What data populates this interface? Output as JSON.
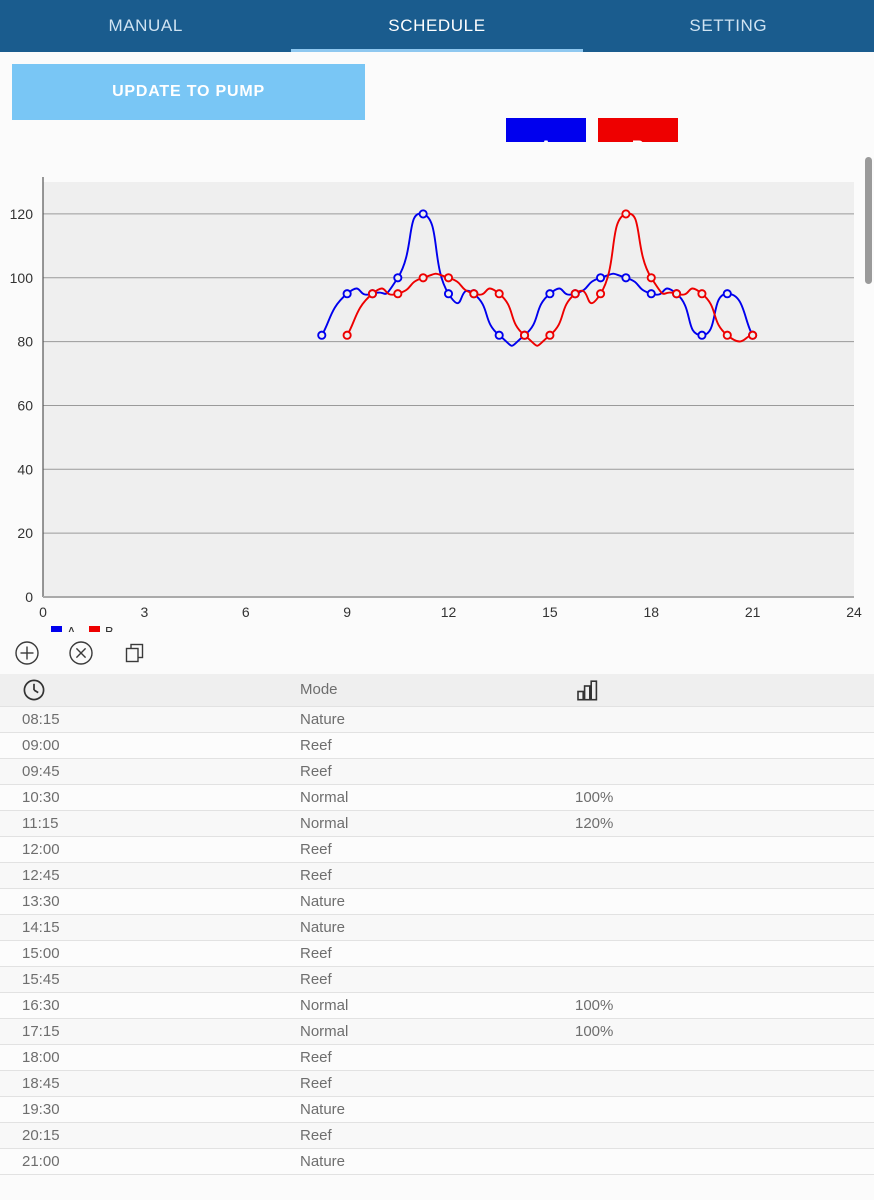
{
  "tabs": [
    {
      "label": "MANUAL",
      "active": false,
      "name": "tab-manual"
    },
    {
      "label": "SCHEDULE",
      "active": true,
      "name": "tab-schedule"
    },
    {
      "label": "SETTING",
      "active": false,
      "name": "tab-setting"
    }
  ],
  "toolbar": {
    "update_label": "UPDATE TO PUMP",
    "pump_a_label": "A",
    "pump_b_label": "B"
  },
  "colors": {
    "tabbar": "#1a5c8e",
    "tab_active_underline": "#8fc8f0",
    "update_button": "#79c6f5",
    "series_a": "#0000ee",
    "series_b": "#ee0000",
    "plot_background": "#efefef",
    "grid": "#9a9a9a"
  },
  "icon_toolbar": [
    {
      "name": "add-icon",
      "glyph": "plus-circle"
    },
    {
      "name": "delete-icon",
      "glyph": "x-circle"
    },
    {
      "name": "copy-icon",
      "glyph": "copy"
    }
  ],
  "table": {
    "headers": {
      "time": "clock-icon",
      "mode": "Mode",
      "value": "bar-chart-icon"
    },
    "rows": [
      {
        "time": "08:15",
        "mode": "Nature",
        "value": ""
      },
      {
        "time": "09:00",
        "mode": "Reef",
        "value": ""
      },
      {
        "time": "09:45",
        "mode": "Reef",
        "value": ""
      },
      {
        "time": "10:30",
        "mode": "Normal",
        "value": "100%"
      },
      {
        "time": "11:15",
        "mode": "Normal",
        "value": "120%"
      },
      {
        "time": "12:00",
        "mode": "Reef",
        "value": ""
      },
      {
        "time": "12:45",
        "mode": "Reef",
        "value": ""
      },
      {
        "time": "13:30",
        "mode": "Nature",
        "value": ""
      },
      {
        "time": "14:15",
        "mode": "Nature",
        "value": ""
      },
      {
        "time": "15:00",
        "mode": "Reef",
        "value": ""
      },
      {
        "time": "15:45",
        "mode": "Reef",
        "value": ""
      },
      {
        "time": "16:30",
        "mode": "Normal",
        "value": "100%"
      },
      {
        "time": "17:15",
        "mode": "Normal",
        "value": "100%"
      },
      {
        "time": "18:00",
        "mode": "Reef",
        "value": ""
      },
      {
        "time": "18:45",
        "mode": "Reef",
        "value": ""
      },
      {
        "time": "19:30",
        "mode": "Nature",
        "value": ""
      },
      {
        "time": "20:15",
        "mode": "Reef",
        "value": ""
      },
      {
        "time": "21:00",
        "mode": "Nature",
        "value": ""
      }
    ]
  },
  "chart_data": {
    "type": "line",
    "title": "",
    "xlabel": "",
    "ylabel": "",
    "xlim": [
      0,
      24
    ],
    "ylim": [
      0,
      130
    ],
    "xticks": [
      0,
      3,
      6,
      9,
      12,
      15,
      18,
      21,
      24
    ],
    "yticks": [
      0,
      20,
      40,
      60,
      80,
      100,
      120
    ],
    "grid": true,
    "legend_position": "bottom-left",
    "series": [
      {
        "name": "A",
        "color": "#0000ee",
        "x": [
          8.25,
          9.0,
          9.75,
          10.5,
          11.25,
          12.0,
          12.75,
          13.5,
          14.25,
          15.0,
          15.75,
          16.5,
          17.25,
          18.0,
          18.75,
          19.5,
          20.25,
          21.0
        ],
        "values": [
          82,
          95,
          95,
          100,
          120,
          95,
          95,
          82,
          82,
          95,
          95,
          100,
          100,
          95,
          95,
          82,
          95,
          82
        ]
      },
      {
        "name": "B",
        "color": "#ee0000",
        "x": [
          9.0,
          9.75,
          10.5,
          11.25,
          12.0,
          12.75,
          13.5,
          14.25,
          15.0,
          15.75,
          16.5,
          17.25,
          18.0,
          18.75,
          19.5,
          20.25,
          21.0
        ],
        "values": [
          82,
          95,
          95,
          100,
          100,
          95,
          95,
          82,
          82,
          95,
          95,
          120,
          100,
          95,
          95,
          82,
          82
        ]
      }
    ],
    "legend": [
      {
        "label": "A",
        "color": "#0000ee"
      },
      {
        "label": "B",
        "color": "#ee0000"
      }
    ]
  }
}
